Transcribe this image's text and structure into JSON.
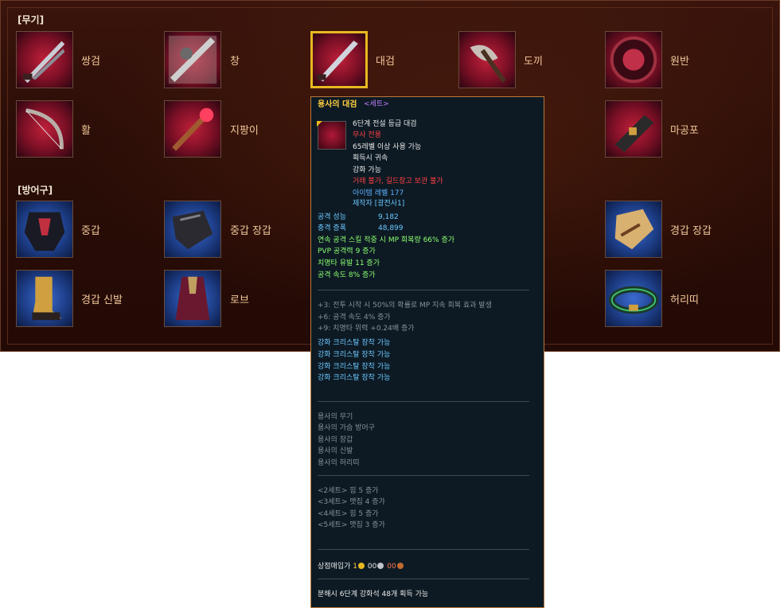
{
  "sections": {
    "weapon_title": "[무기]",
    "armor_title": "[방어구]"
  },
  "weapons": [
    {
      "label": "쌍검"
    },
    {
      "label": "창"
    },
    {
      "label": "대검"
    },
    {
      "label": "도끼"
    },
    {
      "label": "원반"
    },
    {
      "label": "활"
    },
    {
      "label": "지팡이"
    },
    {
      "label": "마공포"
    }
  ],
  "armor": [
    {
      "label": "중갑"
    },
    {
      "label": "중갑 장갑"
    },
    {
      "label": "경갑 장갑"
    },
    {
      "label": "경갑 신발"
    },
    {
      "label": "로브"
    },
    {
      "label": "허리띠"
    }
  ],
  "tooltip": {
    "name": "용사의 대검",
    "set_tag": "<세트>",
    "grade": "6단계 전설 등급 대검",
    "class_only": "무사 전용",
    "level_req": "65레벨 이상 사용 가능",
    "bind": "획득시 귀속",
    "enhance": "강화 가능",
    "no_trade": "거래 불가, 길드창고 보관 불가",
    "item_level": "아이템 레벨 177",
    "maker": "제작자 [광전사1]",
    "stats": [
      {
        "name": "공격 성능",
        "value": "9,182"
      },
      {
        "name": "충격 증폭",
        "value": "48,899"
      }
    ],
    "bonuses": [
      "연속 공격 스킬 적중 시 MP 회복량 66% 증가",
      "PVP 공격력 9 증가",
      "치명타 유발 11 증가",
      "공격 속도 8% 증가"
    ],
    "upgrades": [
      "+3: 전투 시작 시 50%의 확률로 MP 지속 회복 효과 발생",
      "+6: 공격 속도 4% 증가",
      "+9: 치명타 위력 +0.24배 증가"
    ],
    "crystal_slots": [
      "강화 크리스탈 장착 가능",
      "강화 크리스탈 장착 가능",
      "강화 크리스탈 장착 가능",
      "강화 크리스탈 장착 가능"
    ],
    "set_items": [
      "용사의 무기",
      "용사의 가슴 방어구",
      "용사의 장갑",
      "용사의 신발",
      "용사의 허리띠"
    ],
    "set_effects": [
      "<2세트> 힘 5 증가",
      "<3세트> 맷집 4 증가",
      "<4세트> 힘 5 증가",
      "<5세트> 맷집 3 증가"
    ],
    "sell_label": "상점매입가",
    "sell_gold": "1",
    "sell_silver": "00",
    "sell_copper": "00",
    "dismantle": "분해시 6단계 강화석 48개 획득 가능"
  }
}
